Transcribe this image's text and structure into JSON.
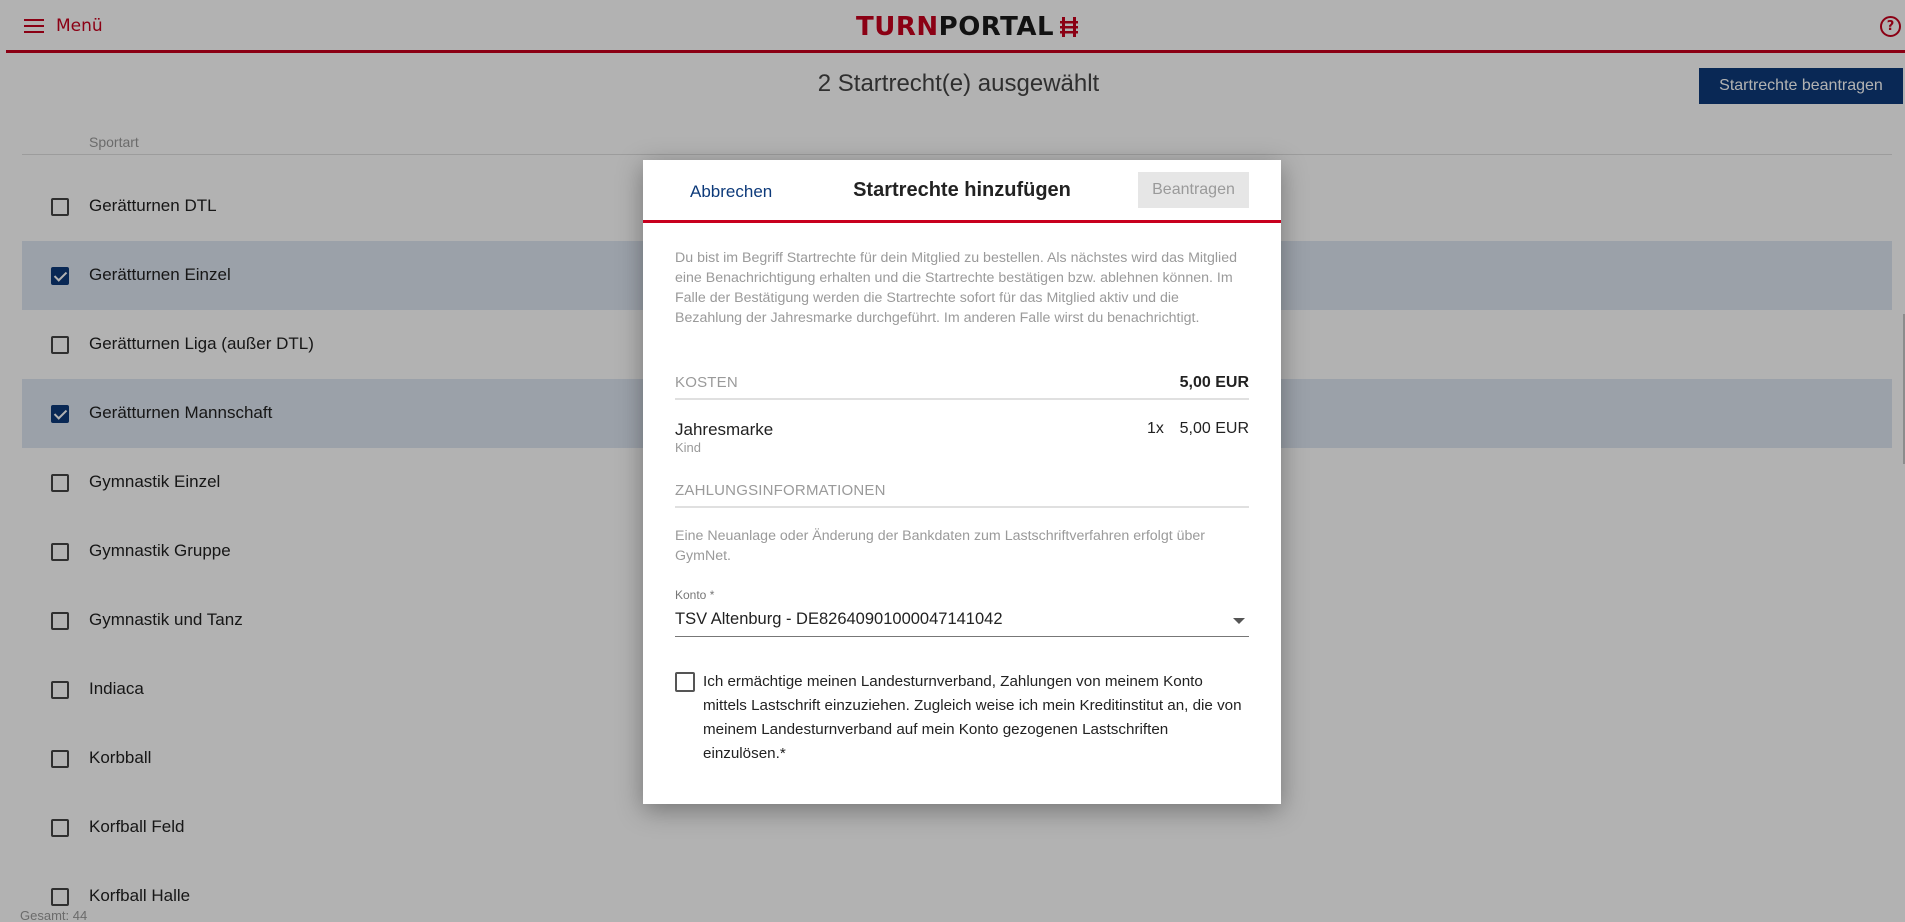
{
  "header": {
    "menu_label": "Menü",
    "brand_part1": "TURN",
    "brand_part2": "PORTAL",
    "help_icon": "?"
  },
  "page": {
    "selected_count": "2 Startrecht(e) ausgewählt",
    "apply_button": "Startrechte beantragen",
    "column_header": "Sportart",
    "footer_total": "Gesamt: 44",
    "sports": [
      {
        "label": "Gerätturnen DTL",
        "checked": false
      },
      {
        "label": "Gerätturnen Einzel",
        "checked": true
      },
      {
        "label": "Gerätturnen Liga (außer DTL)",
        "checked": false
      },
      {
        "label": "Gerätturnen Mannschaft",
        "checked": true
      },
      {
        "label": "Gymnastik Einzel",
        "checked": false
      },
      {
        "label": "Gymnastik Gruppe",
        "checked": false
      },
      {
        "label": "Gymnastik und Tanz",
        "checked": false
      },
      {
        "label": "Indiaca",
        "checked": false
      },
      {
        "label": "Korbball",
        "checked": false
      },
      {
        "label": "Korfball Feld",
        "checked": false
      },
      {
        "label": "Korfball Halle",
        "checked": false
      }
    ]
  },
  "dialog": {
    "cancel_label": "Abbrechen",
    "title": "Startrechte hinzufügen",
    "submit_label": "Beantragen",
    "intro": "Du bist im Begriff Startrechte für dein Mitglied zu bestellen. Als nächstes wird das Mitglied eine Benachrichtigung erhalten und die Startrechte bestätigen bzw. ablehnen können. Im Falle der Bestätigung werden die Startrechte sofort für das Mitglied aktiv und die Bezahlung der Jahresmarke durchgeführt. Im anderen Falle wirst du benachrichtigt.",
    "costs_title": "KOSTEN",
    "costs_total": "5,00 EUR",
    "item_name": "Jahresmarke",
    "item_sub": "Kind",
    "item_qty": "1x",
    "item_price": "5,00 EUR",
    "payment_title": "ZAHLUNGSINFORMATIONEN",
    "payment_note": "Eine Neuanlage oder Änderung der Bankdaten zum Lastschriftverfahren erfolgt über GymNet.",
    "account_label": "Konto *",
    "account_value": "TSV Altenburg - DE82640901000047141042",
    "consent_text": "Ich ermächtige meinen Landesturnverband, Zahlungen von meinem Konto mittels Lastschrift einzuziehen. Zugleich weise ich mein Kreditinstitut an, die von meinem Landesturnverband auf mein Konto gezogenen Lastschriften einzulösen.*",
    "consent_checked": false
  },
  "colors": {
    "brand_red": "#c8001e",
    "primary_blue": "#0d3a7a",
    "selected_row": "#dfe7f3"
  },
  "icons": [
    "hamburger-icon",
    "help-icon",
    "caret-down-icon",
    "checkbox-icon"
  ]
}
